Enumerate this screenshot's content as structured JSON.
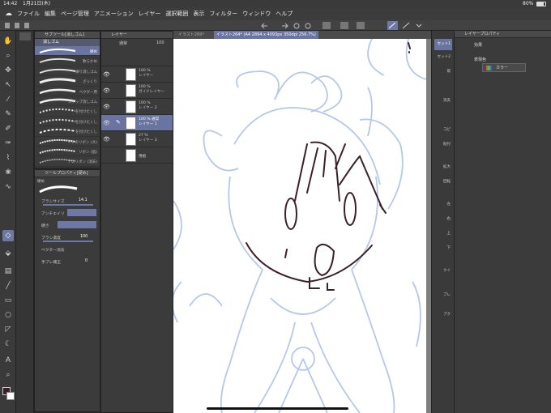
{
  "status": {
    "time": "14:42",
    "date": "1月21日(木)",
    "battery": "80%"
  },
  "menu": [
    "ファイル",
    "編集",
    "ページ管理",
    "アニメーション",
    "レイヤー",
    "選択範囲",
    "表示",
    "フィルター",
    "ウィンドウ",
    "ヘルプ"
  ],
  "subtool": {
    "title": "サブツール[消しゴム]",
    "tab": "消しゴム",
    "brushes": [
      {
        "label": "硬め",
        "selected": true
      },
      {
        "label": "軟らかめ",
        "selected": false
      },
      {
        "label": "練り消しゴム",
        "selected": false
      },
      {
        "label": "ざっくり",
        "selected": false
      },
      {
        "label": "ベクター用",
        "selected": false
      },
      {
        "label": "スナップ消しゴム",
        "selected": false
      },
      {
        "label": "を付けたくし",
        "selected": false
      },
      {
        "label": "を付けたくし",
        "selected": false
      },
      {
        "label": "を付けたくし",
        "selected": false
      },
      {
        "label": "イチのリボン (大)",
        "selected": false
      },
      {
        "label": "リボン (肌)",
        "selected": false
      },
      {
        "label": "ナのリボン (消去)",
        "selected": false
      },
      {
        "label": "かけのリボン (消去)",
        "selected": false
      }
    ]
  },
  "toolprop": {
    "title": "ツールプロパティ[硬め]",
    "name": "硬め",
    "brush_size_label": "ブラシサイズ",
    "brush_size_value": "14.1",
    "antialias_label": "アンチエイリ",
    "hardness_label": "硬さ",
    "density_label": "ブラシ濃度",
    "density_value": "100",
    "vector_erase_label": "ベクター消去",
    "stabilize_label": "手ブレ補正",
    "stabilize_value": "0"
  },
  "layers": {
    "title": "レイヤー",
    "blend_mode": "通常",
    "opacity": "100",
    "items": [
      {
        "pct": "100 %",
        "name": "レイヤー",
        "selected": false
      },
      {
        "pct": "100 %",
        "name": "ガイドレイヤー",
        "selected": false
      },
      {
        "pct": "100 %",
        "name": "レイヤー 2",
        "selected": false
      },
      {
        "pct": "100 % 通常",
        "name": "レイヤー 1",
        "selected": true
      },
      {
        "pct": "27 %",
        "name": "レイヤー 3",
        "selected": false
      },
      {
        "pct": "",
        "name": "用紙",
        "selected": false
      }
    ]
  },
  "document": {
    "tab1": "イラスト269*",
    "tab2": "イラスト264* (A4 2894 x 4093px 350dpi 256.7%)"
  },
  "right_strip": [
    "セット1",
    "セット2",
    "取",
    "消去",
    "コピ",
    "貼付",
    "拡大",
    "回転",
    "左",
    "右",
    "上",
    "下",
    "クイ",
    "プレ",
    "アク"
  ],
  "layer_property": {
    "title": "レイヤープロパティ",
    "effect_label": "効果",
    "color_label": "表現色",
    "color_value": "カラー"
  }
}
